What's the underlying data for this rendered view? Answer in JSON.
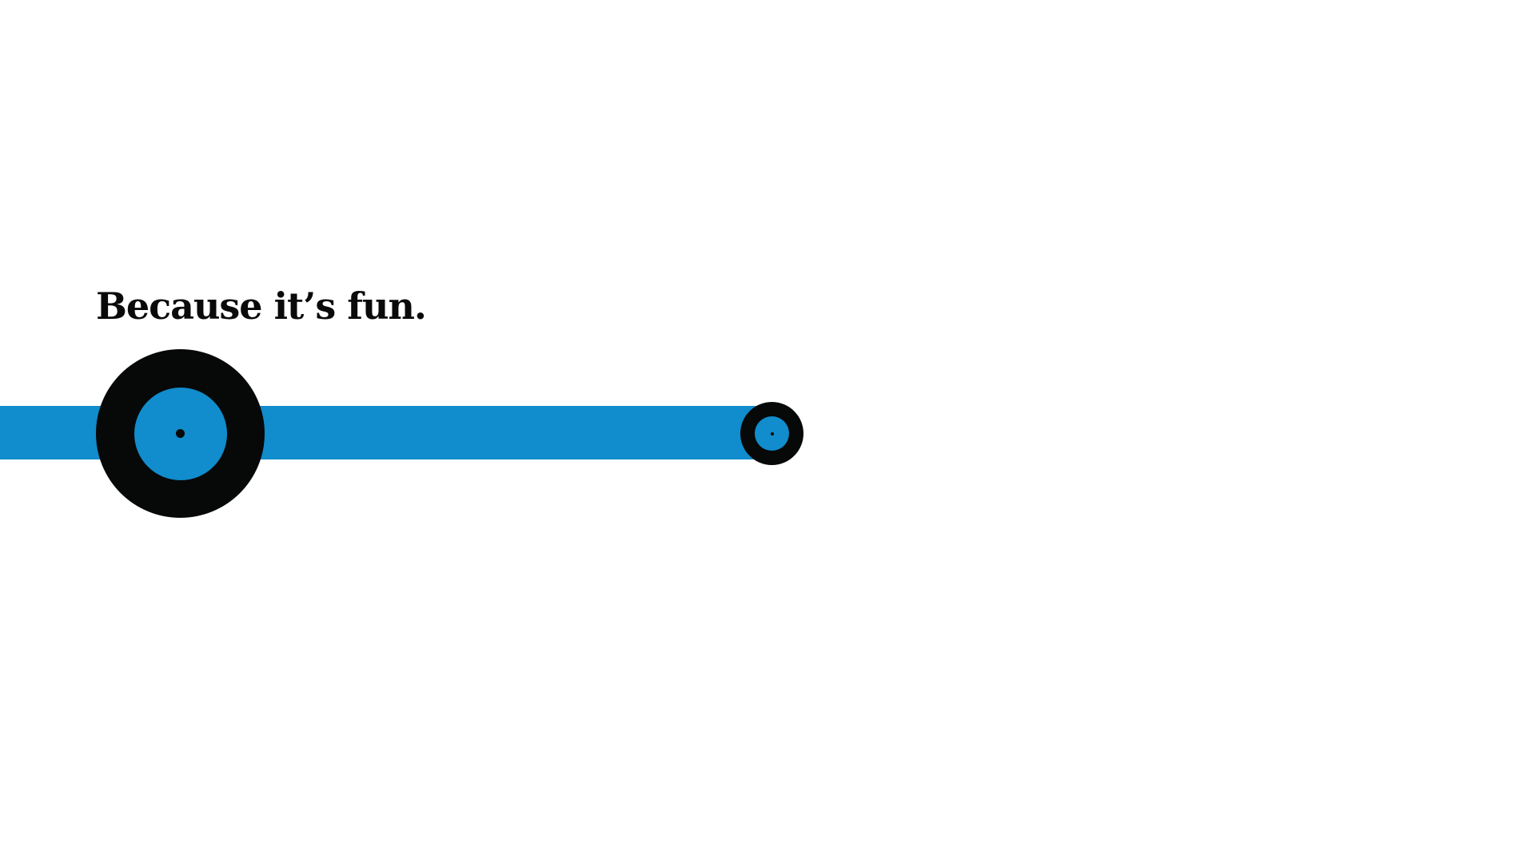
{
  "slide": {
    "headline": "Because it’s fun."
  },
  "colors": {
    "background": "#ffffff",
    "track": "#118ccc",
    "disc_outer": "#070808",
    "disc_inner": "#118ccc",
    "text": "#0a0a0a"
  }
}
